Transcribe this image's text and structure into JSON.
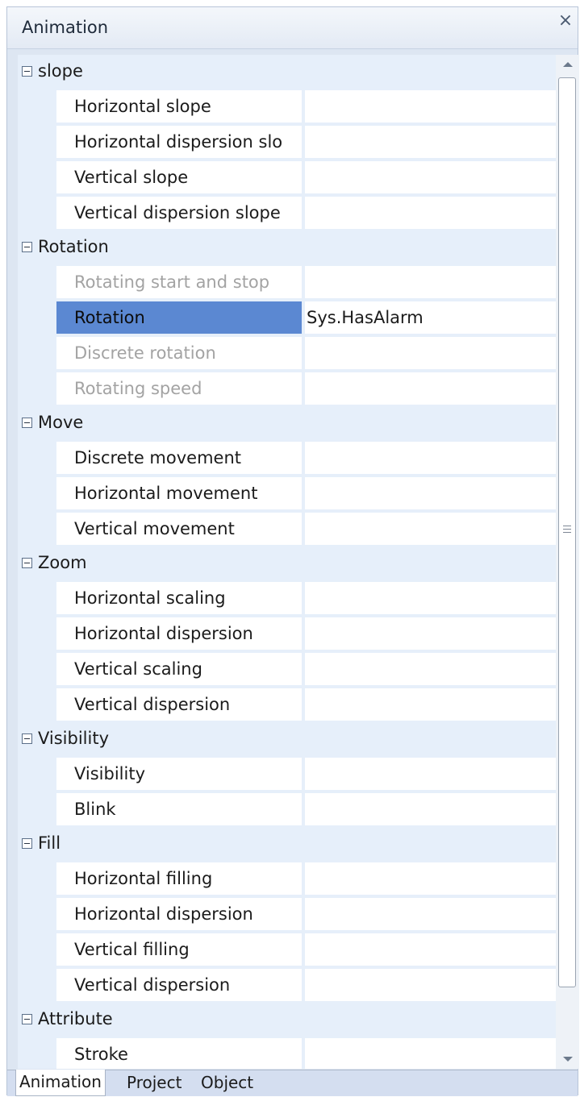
{
  "panel": {
    "title": "Animation",
    "close_glyph": "×"
  },
  "categories": [
    {
      "label": "slope",
      "properties": [
        {
          "name": "Horizontal slope",
          "value": ""
        },
        {
          "name": "Horizontal dispersion slo",
          "value": ""
        },
        {
          "name": "Vertical slope",
          "value": ""
        },
        {
          "name": "Vertical dispersion slope",
          "value": ""
        }
      ]
    },
    {
      "label": "Rotation",
      "properties": [
        {
          "name": "Rotating start and stop",
          "value": "",
          "state": "disabled"
        },
        {
          "name": "Rotation",
          "value": "Sys.HasAlarm",
          "state": "selected"
        },
        {
          "name": "Discrete rotation",
          "value": "",
          "state": "disabled"
        },
        {
          "name": "Rotating speed",
          "value": "",
          "state": "disabled"
        }
      ]
    },
    {
      "label": "Move",
      "properties": [
        {
          "name": "Discrete movement",
          "value": ""
        },
        {
          "name": "Horizontal movement",
          "value": ""
        },
        {
          "name": "Vertical movement",
          "value": ""
        }
      ]
    },
    {
      "label": "Zoom",
      "properties": [
        {
          "name": "Horizontal scaling",
          "value": ""
        },
        {
          "name": "Horizontal dispersion",
          "value": ""
        },
        {
          "name": "Vertical scaling",
          "value": ""
        },
        {
          "name": "Vertical dispersion",
          "value": ""
        }
      ]
    },
    {
      "label": "Visibility",
      "properties": [
        {
          "name": "Visibility",
          "value": ""
        },
        {
          "name": "Blink",
          "value": ""
        }
      ]
    },
    {
      "label": "Fill",
      "properties": [
        {
          "name": "Horizontal filling",
          "value": ""
        },
        {
          "name": "Horizontal dispersion",
          "value": ""
        },
        {
          "name": "Vertical filling",
          "value": ""
        },
        {
          "name": "Vertical dispersion",
          "value": ""
        }
      ]
    },
    {
      "label": "Attribute",
      "properties": [
        {
          "name": "Stroke",
          "value": ""
        }
      ]
    }
  ],
  "tabs": [
    "Animation",
    "Project",
    "Object"
  ],
  "icons": {
    "close": "close-icon",
    "collapse": "collapse-minus-icon",
    "scroll_up": "scroll-up-arrow-icon",
    "scroll_down": "scroll-down-arrow-icon",
    "grip": "scroll-grip-icon"
  },
  "colors": {
    "category_background": "#e6effa",
    "selected_row": "#5b88d2",
    "disabled_text": "#a3a3a3"
  }
}
